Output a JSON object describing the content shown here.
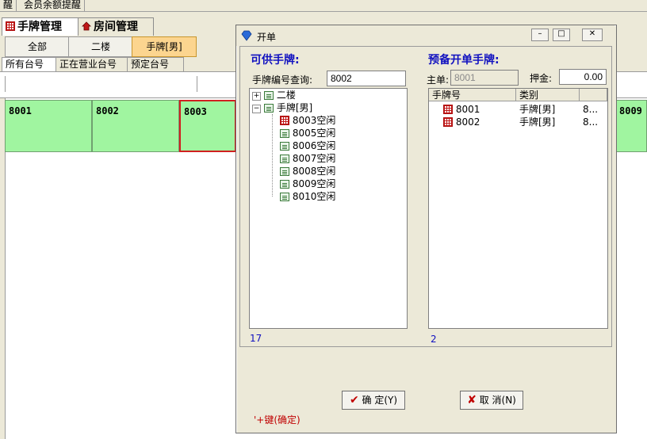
{
  "top_tabs": [
    {
      "label": "醒"
    },
    {
      "label": "会员余额提醒"
    }
  ],
  "main_tabs": [
    {
      "label": "手牌管理",
      "icon": "grid-icon",
      "active": true
    },
    {
      "label": "房间管理",
      "icon": "house-icon",
      "active": false
    }
  ],
  "categories": [
    {
      "label": "全部"
    },
    {
      "label": "二楼"
    },
    {
      "label": "手牌[男]",
      "selected": true
    }
  ],
  "sub_tabs": [
    {
      "label": "所有台号",
      "active": true
    },
    {
      "label": "正在营业台号"
    },
    {
      "label": "预定台号"
    }
  ],
  "cards": [
    {
      "label": "8001"
    },
    {
      "label": "8002"
    },
    {
      "label": "8003",
      "selected": true
    },
    {
      "label": "8009"
    }
  ],
  "colors": {
    "card_bg": "#a0f5a0",
    "selected_border": "#d02020",
    "heading_blue": "#1010c0",
    "selected_category": "#fcd58f"
  },
  "dialog": {
    "title": "开单",
    "left": {
      "heading": "可供手牌:",
      "query_label": "手牌编号查询:",
      "query_value": "8002",
      "tree": [
        {
          "label": "二楼",
          "expanded": false
        },
        {
          "label": "手牌[男]",
          "expanded": true
        },
        {
          "label": "8003空闲",
          "icon": "grid-icon"
        },
        {
          "label": "8005空闲",
          "icon": "doc-icon"
        },
        {
          "label": "8006空闲",
          "icon": "doc-icon"
        },
        {
          "label": "8007空闲",
          "icon": "doc-icon"
        },
        {
          "label": "8008空闲",
          "icon": "doc-icon"
        },
        {
          "label": "8009空闲",
          "icon": "doc-icon"
        },
        {
          "label": "8010空闲",
          "icon": "doc-icon"
        }
      ],
      "count": "17"
    },
    "right": {
      "heading": "预备开单手牌:",
      "master_label": "主单:",
      "master_value": "8001",
      "deposit_label": "押金:",
      "deposit_value": "0.00",
      "columns": [
        "手牌号",
        "类别"
      ],
      "rows": [
        {
          "no": "8001",
          "type": "手牌[男]",
          "extra": "8..."
        },
        {
          "no": "8002",
          "type": "手牌[男]",
          "extra": "8..."
        }
      ],
      "count": "2"
    },
    "ok_label": "确 定(Y)",
    "cancel_label": "取 消(N)",
    "hint": "'+键(确定)"
  }
}
